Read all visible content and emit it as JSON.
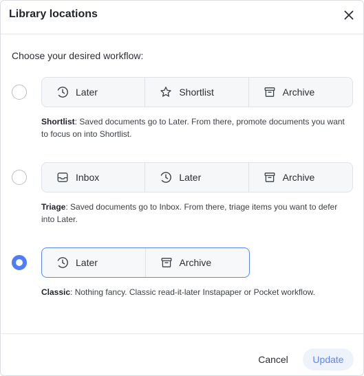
{
  "dialog": {
    "title": "Library locations",
    "close_icon": "close-icon"
  },
  "prompt": "Choose your desired workflow:",
  "options": [
    {
      "selected": false,
      "segments": [
        {
          "icon": "clock-icon",
          "label": "Later"
        },
        {
          "icon": "star-icon",
          "label": "Shortlist"
        },
        {
          "icon": "archive-icon",
          "label": "Archive"
        }
      ],
      "name": "Shortlist",
      "description": ": Saved documents go to Later. From there, promote documents you want to focus on into Shortlist."
    },
    {
      "selected": false,
      "segments": [
        {
          "icon": "inbox-icon",
          "label": "Inbox"
        },
        {
          "icon": "clock-icon",
          "label": "Later"
        },
        {
          "icon": "archive-icon",
          "label": "Archive"
        }
      ],
      "name": "Triage",
      "description": ": Saved documents go to Inbox. From there, triage items you want to defer into Later."
    },
    {
      "selected": true,
      "segments": [
        {
          "icon": "clock-icon",
          "label": "Later"
        },
        {
          "icon": "archive-icon",
          "label": "Archive"
        }
      ],
      "name": "Classic",
      "description": ": Nothing fancy. Classic read-it-later Instapaper or Pocket workflow."
    }
  ],
  "footer": {
    "cancel_label": "Cancel",
    "update_label": "Update"
  },
  "colors": {
    "accent": "#4f7cf7",
    "update_text": "#5b86f5",
    "update_bg": "#eef2fb"
  }
}
